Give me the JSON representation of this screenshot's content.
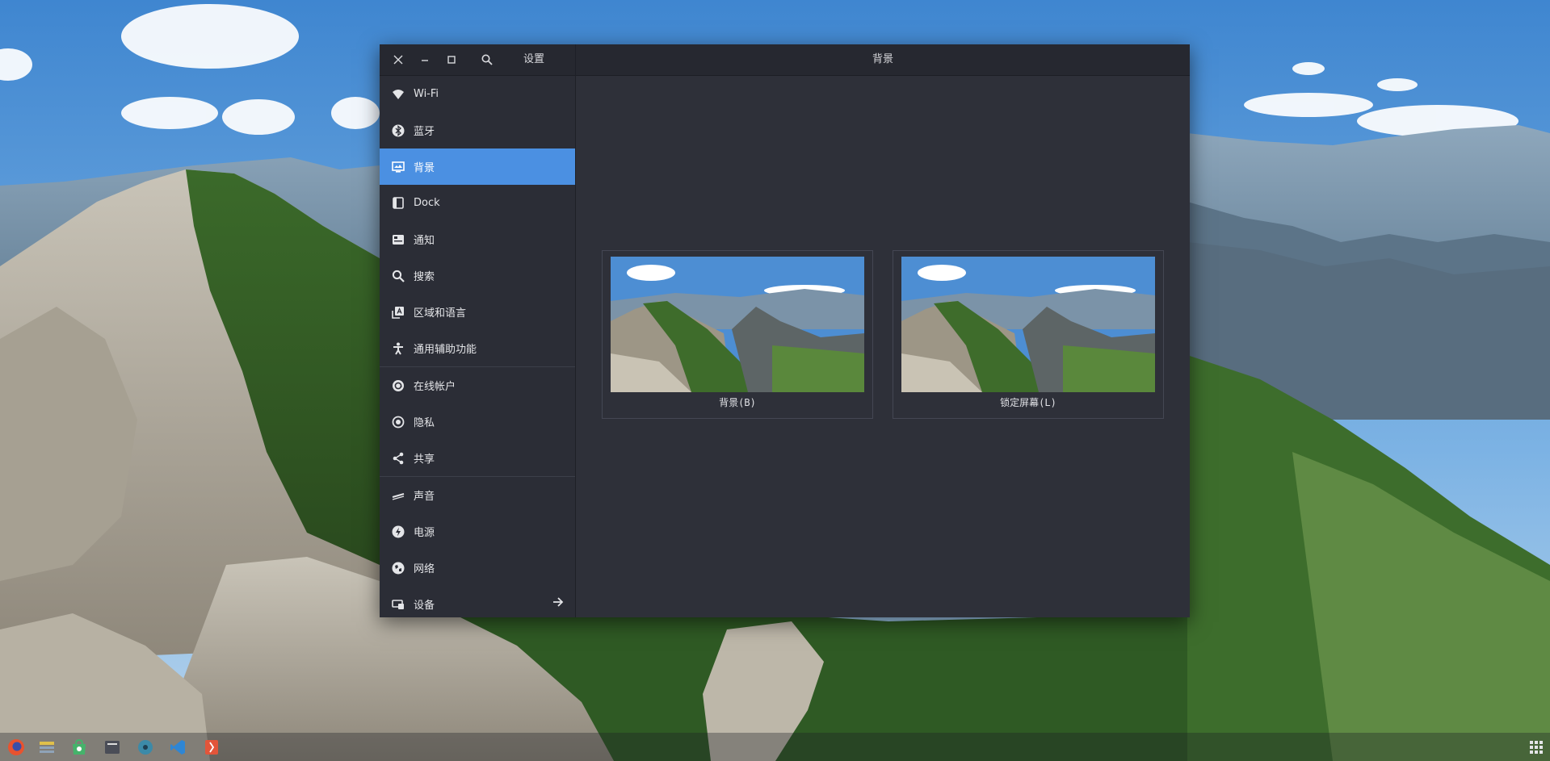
{
  "window": {
    "sidebar_title": "设置",
    "content_title": "背景",
    "controls": [
      "close-icon",
      "minimize-icon",
      "maximize-icon",
      "search-icon"
    ]
  },
  "sidebar": {
    "items": [
      {
        "label": "Wi-Fi",
        "icon": "wifi-icon"
      },
      {
        "label": "蓝牙",
        "icon": "bluetooth-icon"
      },
      {
        "label": "背景",
        "icon": "background-icon",
        "active": true
      },
      {
        "label": "Dock",
        "icon": "dock-icon"
      },
      {
        "label": "通知",
        "icon": "notification-icon"
      },
      {
        "label": "搜索",
        "icon": "search-icon"
      },
      {
        "label": "区域和语言",
        "icon": "region-language-icon"
      },
      {
        "label": "通用辅助功能",
        "icon": "accessibility-icon"
      },
      {
        "label": "在线帐户",
        "icon": "online-accounts-icon"
      },
      {
        "label": "隐私",
        "icon": "privacy-icon"
      },
      {
        "label": "共享",
        "icon": "share-icon"
      },
      {
        "label": "声音",
        "icon": "sound-icon"
      },
      {
        "label": "电源",
        "icon": "power-icon"
      },
      {
        "label": "网络",
        "icon": "network-icon"
      },
      {
        "label": "设备",
        "icon": "devices-icon"
      }
    ]
  },
  "content": {
    "background_caption": "背景(B)",
    "lockscreen_caption": "锁定屏幕(L)"
  },
  "taskbar": {
    "icons": [
      "firefox-icon",
      "files-icon",
      "store-icon",
      "folder-icon",
      "disk-icon",
      "code-editor-icon",
      "git-icon"
    ]
  },
  "colors": {
    "accent": "#4b90e2",
    "sidebar_bg": "#2b2d36",
    "content_bg": "#2e3039"
  }
}
